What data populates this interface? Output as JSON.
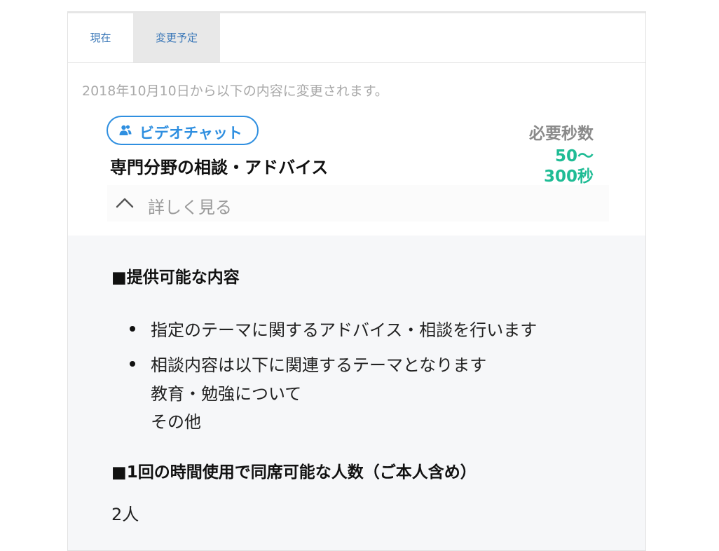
{
  "tabs": [
    {
      "label": "現在"
    },
    {
      "label": "変更予定"
    }
  ],
  "notice": "2018年10月10日から以下の内容に変更されます。",
  "service": {
    "badge_icon": "users-icon",
    "badge_label": "ビデオチャット",
    "title": "専門分野の相談・アドバイス",
    "required_seconds_label": "必要秒数",
    "required_seconds_min": "50〜",
    "required_seconds_max": "300秒"
  },
  "toggle": {
    "icon": "chevron-up-icon",
    "label": "詳しく見る"
  },
  "details": {
    "section1_heading": "■提供可能な内容",
    "section1_items": [
      {
        "line1": "指定のテーマに関するアドバイス・相談を行います"
      },
      {
        "line1": "相談内容は以下に関連するテーマとなります",
        "line2": "教育・勉強について",
        "line3": "その他"
      }
    ],
    "section2_heading": "■1回の時間使用で同席可能な人数（ご本人含め）",
    "section2_value": "2人"
  },
  "colors": {
    "tab_text": "#3b78b8",
    "badge": "#2f8fe0",
    "seconds": "#1fbc95",
    "detail_bg": "#f6f7f9"
  }
}
